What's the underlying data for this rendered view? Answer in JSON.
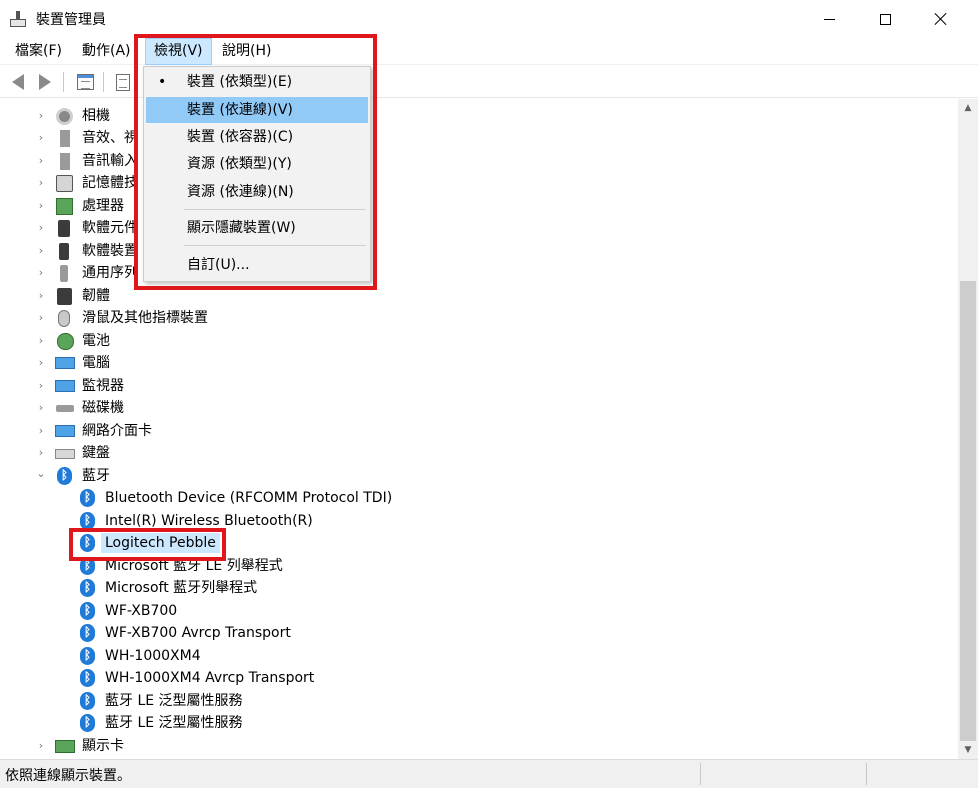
{
  "window": {
    "title": "裝置管理員",
    "minimize_icon": "minimize-icon",
    "maximize_icon": "maximize-icon",
    "close_icon": "close-icon"
  },
  "menubar": {
    "items": [
      {
        "label": "檔案(F)"
      },
      {
        "label": "動作(A)"
      },
      {
        "label": "檢視(V)"
      },
      {
        "label": "說明(H)"
      }
    ],
    "active_index": 2
  },
  "toolbar": {
    "back_icon": "back-arrow-icon",
    "forward_icon": "forward-arrow-icon",
    "properties_icon": "properties-icon",
    "help_icon": "document-icon"
  },
  "view_menu": {
    "items": [
      {
        "label": "裝置 (依類型)(E)",
        "checked": true
      },
      {
        "label": "裝置 (依連線)(V)",
        "hovered": true
      },
      {
        "label": "裝置 (依容器)(C)"
      },
      {
        "label": "資源 (依類型)(Y)"
      },
      {
        "label": "資源 (依連線)(N)"
      },
      {
        "label": "顯示隱藏裝置(W)"
      },
      {
        "label": "自訂(U)..."
      }
    ],
    "bullet": "•"
  },
  "tree": {
    "categories": [
      {
        "label": "相機",
        "icon": "camera-icon"
      },
      {
        "label": "音效、視",
        "icon": "speaker-icon"
      },
      {
        "label": "音訊輸入",
        "icon": "audio-input-icon"
      },
      {
        "label": "記憶體技",
        "icon": "memory-icon"
      },
      {
        "label": "處理器",
        "icon": "processor-icon"
      },
      {
        "label": "軟體元件",
        "icon": "software-component-icon"
      },
      {
        "label": "軟體裝置",
        "icon": "software-device-icon"
      },
      {
        "label": "通用序列",
        "icon": "usb-icon"
      },
      {
        "label": "韌體",
        "icon": "firmware-icon"
      },
      {
        "label": "滑鼠及其他指標裝置",
        "icon": "mouse-icon"
      },
      {
        "label": "電池",
        "icon": "battery-icon"
      },
      {
        "label": "電腦",
        "icon": "computer-icon"
      },
      {
        "label": "監視器",
        "icon": "monitor-icon"
      },
      {
        "label": "磁碟機",
        "icon": "disk-drive-icon"
      },
      {
        "label": "網路介面卡",
        "icon": "network-adapter-icon"
      },
      {
        "label": "鍵盤",
        "icon": "keyboard-icon"
      }
    ],
    "bluetooth": {
      "label": "藍牙",
      "icon": "bluetooth-icon",
      "children": [
        {
          "label": "Bluetooth Device (RFCOMM Protocol TDI)"
        },
        {
          "label": "Intel(R) Wireless Bluetooth(R)"
        },
        {
          "label": "Logitech Pebble",
          "selected": true
        },
        {
          "label": "Microsoft 藍牙 LE 列舉程式"
        },
        {
          "label": "Microsoft 藍牙列舉程式"
        },
        {
          "label": "WF-XB700"
        },
        {
          "label": "WF-XB700 Avrcp Transport"
        },
        {
          "label": "WH-1000XM4"
        },
        {
          "label": "WH-1000XM4 Avrcp Transport"
        },
        {
          "label": "藍牙 LE 泛型屬性服務"
        },
        {
          "label": "藍牙 LE 泛型屬性服務"
        }
      ]
    },
    "after": [
      {
        "label": "顯示卡",
        "icon": "display-adapter-icon"
      }
    ],
    "expand_glyph": "›",
    "collapse_glyph": "⌄"
  },
  "statusbar": {
    "text": "依照連線顯示裝置。"
  },
  "scrollbar": {
    "up_glyph": "▲",
    "down_glyph": "▼"
  },
  "colors": {
    "annotation_red": "#e0161d",
    "menu_hover": "#91c9f7",
    "selection": "#cce8ff",
    "bluetooth_blue": "#1f7ad8"
  }
}
